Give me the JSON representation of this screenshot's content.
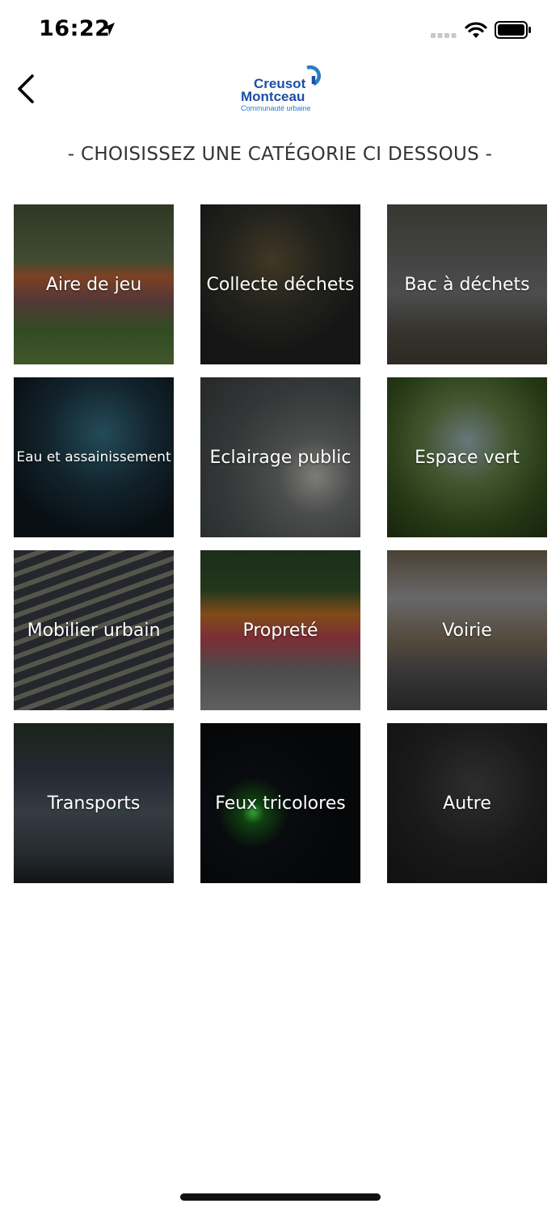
{
  "status": {
    "time": "16:22"
  },
  "header": {
    "logo_line1": "Creusot",
    "logo_line2": "Montceau",
    "logo_line3": "Communauté urbaine"
  },
  "heading": "- CHOISISSEZ UNE CATÉGORIE CI DESSOUS -",
  "categories": [
    {
      "label": "Aire de jeu"
    },
    {
      "label": "Collecte déchets"
    },
    {
      "label": "Bac à déchets"
    },
    {
      "label": "Eau et assainissement"
    },
    {
      "label": "Eclairage public"
    },
    {
      "label": "Espace vert"
    },
    {
      "label": "Mobilier urbain"
    },
    {
      "label": "Propreté"
    },
    {
      "label": "Voirie"
    },
    {
      "label": "Transports"
    },
    {
      "label": "Feux tricolores"
    },
    {
      "label": "Autre"
    }
  ],
  "colors": {
    "brand_blue": "#1d4fa3",
    "brand_light": "#2a7cc7"
  }
}
